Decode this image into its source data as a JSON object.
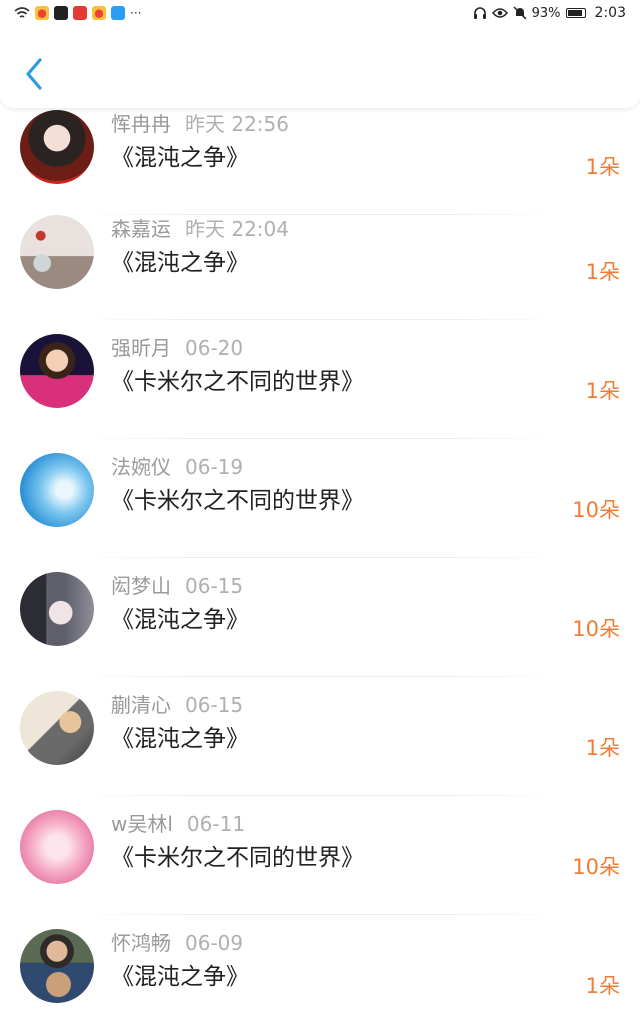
{
  "status_bar": {
    "battery_text": "93%",
    "time": "2:03",
    "more_text": "···"
  },
  "header": {
    "back_icon": "chevron-left-icon",
    "accent": "#2c9be0"
  },
  "records": [
    {
      "name": "恽冉冉",
      "date": "昨天 22:56",
      "book": "《混沌之争》",
      "amount": "1朵"
    },
    {
      "name": "森嘉运",
      "date": "昨天 22:04",
      "book": "《混沌之争》",
      "amount": "1朵"
    },
    {
      "name": "强昕月",
      "date": "06-20",
      "book": "《卡米尔之不同的世界》",
      "amount": "1朵"
    },
    {
      "name": "法婉仪",
      "date": "06-19",
      "book": "《卡米尔之不同的世界》",
      "amount": "10朵"
    },
    {
      "name": "闳梦山",
      "date": "06-15",
      "book": "《混沌之争》",
      "amount": "10朵"
    },
    {
      "name": "蒯清心",
      "date": "06-15",
      "book": "《混沌之争》",
      "amount": "1朵"
    },
    {
      "name": "w吴林l",
      "date": "06-11",
      "book": "《卡米尔之不同的世界》",
      "amount": "10朵"
    },
    {
      "name": "怀鸿畅",
      "date": "06-09",
      "book": "《混沌之争》",
      "amount": "1朵"
    }
  ],
  "colors": {
    "amount": "#f07c35",
    "name": "#9a9a9a",
    "text": "#222222"
  }
}
